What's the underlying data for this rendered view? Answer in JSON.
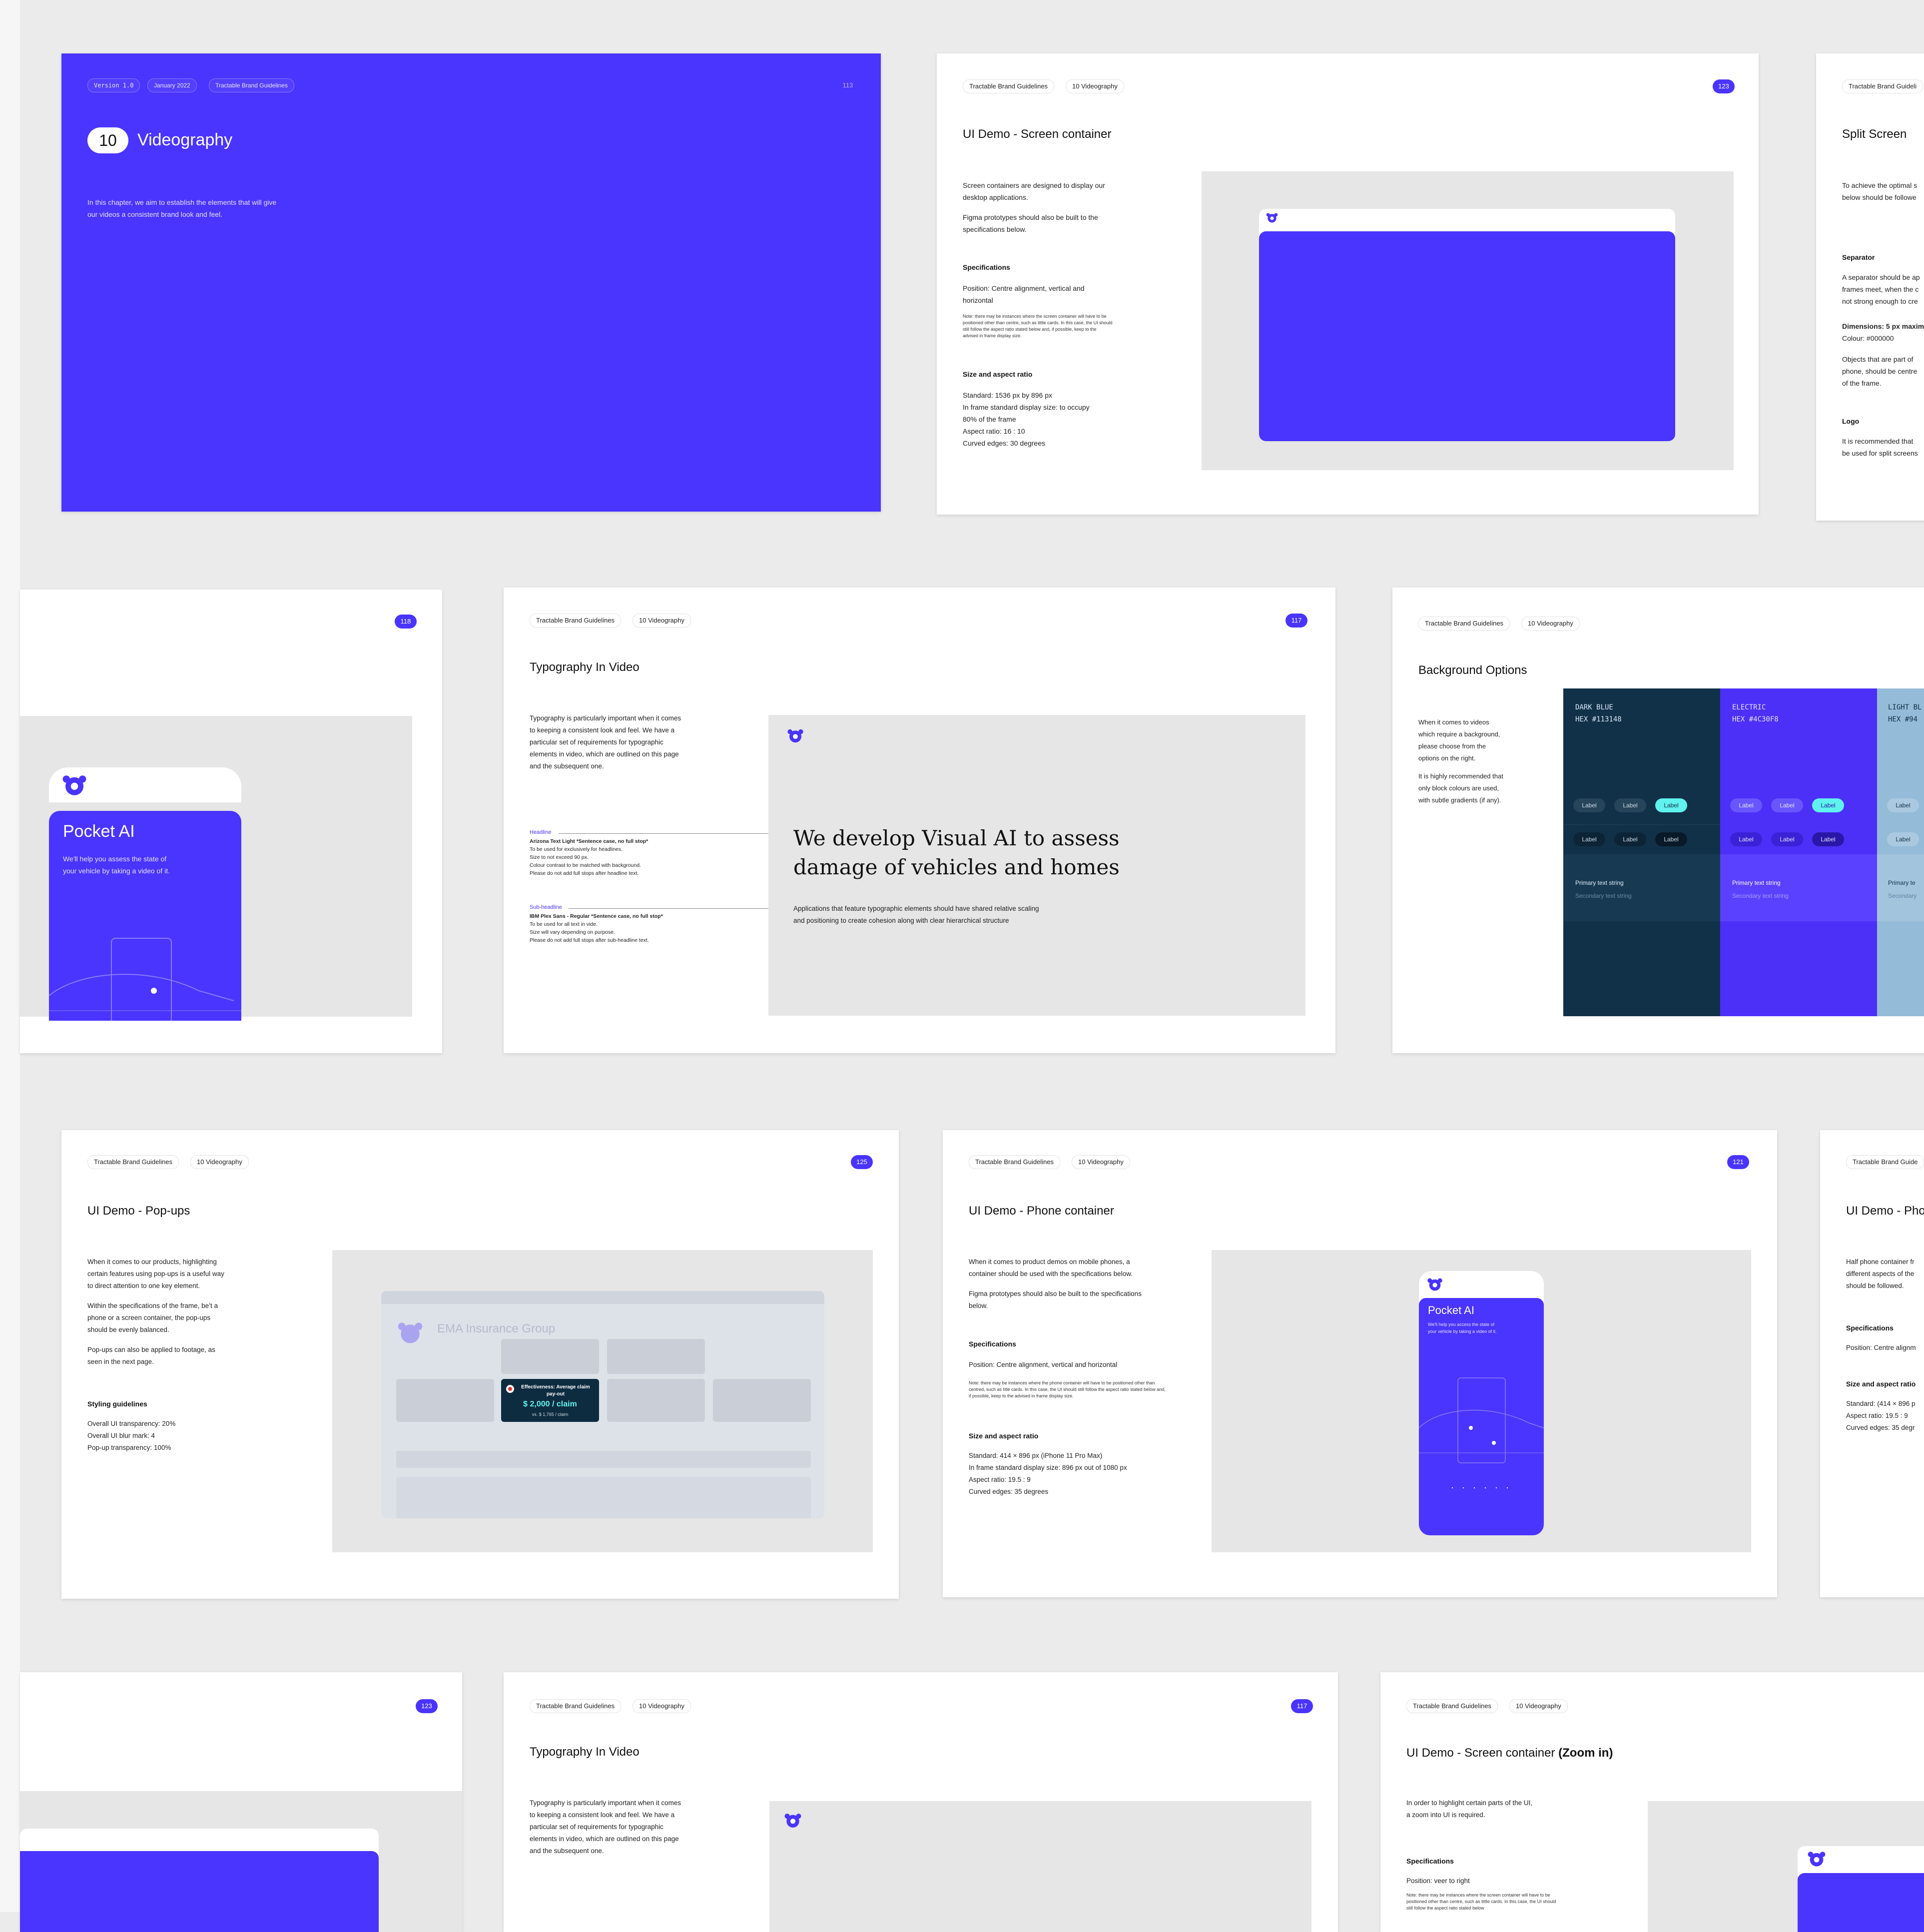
{
  "brand": "Tractable Brand Guidelines",
  "chapter": "10 Videography",
  "colors": {
    "electric": "#4C30F8",
    "dark_blue": "#113148",
    "light_blue": "#94BBD8",
    "gray_bg": "#E6E6E6"
  },
  "slide_cover": {
    "version": "Version 1.0",
    "date": "January 2022",
    "brand": "Tractable Brand Guidelines",
    "page": "113",
    "chapter_num": "10",
    "chapter_title": "Videography",
    "intro_1": "In this chapter, we aim to establish the elements that will give",
    "intro_2": "our videos a consistent brand look and feel."
  },
  "slide_screen": {
    "page": "123",
    "title": "UI Demo - Screen container",
    "p1": "Screen containers are designed to display our desktop applications.",
    "p2": "Figma prototypes should also be built to the specifications below.",
    "spec_head": "Specifications",
    "spec": "Position: Centre alignment, vertical and horizontal",
    "note": "Note: there may be instances where the screen container will have to be positioned other than centre, such as tittle cards. In this case, the UI should still follow the aspect ratio stated below and, if possible, keep to the advised in frame display size.",
    "size_head": "Size and aspect ratio",
    "size_lines": [
      "Standard: 1536 px by 896 px",
      "In frame standard display size: to occupy",
      "80% of the frame",
      "Aspect ratio: 16 : 10",
      "Curved edges: 30 degrees"
    ]
  },
  "slide_split": {
    "brand": "Tractable Brand Guideli",
    "title": "Split Screen",
    "intro": [
      "To achieve the optimal s",
      "below should be followe"
    ],
    "sep_head": "Separator",
    "sep": [
      "A separator should be ap",
      "frames meet, when the c",
      "not strong enough to cre"
    ],
    "dim": "Dimensions: 5 px maxim",
    "colour": "Colour: #000000",
    "objects": [
      "Objects that are part of",
      "phone, should be centre",
      "of the frame."
    ],
    "logo_head": "Logo",
    "logo": [
      "It is recommended that",
      "be used for split screens"
    ]
  },
  "slide_pocket": {
    "page": "118",
    "app_title": "Pocket AI",
    "app_sub": [
      "We'll help you assess the state of",
      "your vehicle by taking a video of it."
    ]
  },
  "slide_typo": {
    "page": "117",
    "title": "Typography In Video",
    "intro": [
      "Typography is particularly important when it comes",
      "to keeping a consistent look and feel. We have a",
      "particular set of requirements for typographic",
      "elements in video, which are outlined on this page",
      "and the subsequent one."
    ],
    "headline_label": "Headline",
    "headline_lines": [
      "Arizona Text Light *Sentence case, no full stop*",
      "To be used for exclusively for headlines.",
      "Size to not exceed 90 px.",
      "Colour contrast to be matched with background.",
      "Please do not add full stops after headline text."
    ],
    "sub_label": "Sub-headline",
    "sub_lines": [
      "IBM Plex Sans - Regular *Sentence case, no full stop*",
      "To be used for all text in vide.",
      "Size will vary depending on purpose.",
      "Please do not add full stops after sub-headline text."
    ],
    "sample_headline_1": "We develop Visual AI to assess",
    "sample_headline_2": "damage of vehicles and homes",
    "sample_sub_1": "Applications that feature typographic elements should have shared relative scaling",
    "sample_sub_2": "and positioning to create cohesion along with clear hierarchical structure"
  },
  "slide_bg": {
    "title": "Background Options",
    "p1": [
      "When it comes to videos",
      "which require a background,",
      "please choose from the",
      "options on the right."
    ],
    "p2": [
      "It is highly recommended that",
      "only block colours are used,",
      "with subtle gradients (if any)."
    ],
    "swatches": [
      {
        "name": "DARK BLUE",
        "hex": "HEX #113148"
      },
      {
        "name": "ELECTRIC",
        "hex": "HEX #4C30F8"
      },
      {
        "name": "LIGHT BL",
        "hex": "HEX #94"
      }
    ],
    "label": "Label",
    "primary": "Primary text string",
    "secondary": "Secondary text string",
    "primary_cut": "Primary te",
    "secondary_cut": "Secondary"
  },
  "slide_popups": {
    "page": "125",
    "title": "UI Demo - Pop-ups",
    "p1": [
      "When it comes to our products, highlighting",
      "certain features using pop-ups is a useful way",
      "to direct attention to one key element."
    ],
    "p2": [
      "Within the specifications of the frame, be’t a",
      "phone or a screen container, the pop-ups",
      "should be evenly balanced."
    ],
    "p3": [
      "Pop-ups can also be applied to footage, as",
      "seen in the next page."
    ],
    "style_head": "Styling guidelines",
    "style_lines": [
      "Overall UI transparency: 20%",
      "Overall UI blur mark: 4",
      "Pop-up transparency: 100%"
    ],
    "ui_title": "EMA Insurance Group",
    "popup_label": "Effectiveness: Average claim pay-out",
    "popup_value": "$ 2,000 / claim",
    "popup_sub": "vs. $ 1,765 / claim"
  },
  "slide_phone": {
    "page": "121",
    "title": "UI Demo - Phone container",
    "p1": [
      "When it comes to product demos on mobile phones, a",
      "container should be used with the specifications below."
    ],
    "p2": [
      "Figma prototypes should also be built to the specifications",
      "below."
    ],
    "spec_head": "Specifications",
    "spec": "Position: Centre alignment, vertical and horizontal",
    "note": "Note: there may be instances where the phone container will have to be positioned other than centred, such as title cards. In this case, the UI should still follow the aspect ratio stated below and, if possible, keep to the advised in frame display size.",
    "size_head": "Size and aspect ratio",
    "size_lines": [
      "Standard: 414 × 896 px (iPhone 11 Pro Max)",
      "In frame standard display size: 896 px out of 1080 px",
      "Aspect ratio: 19.5 : 9",
      "Curved edges: 35 degrees"
    ],
    "app_title": "Pocket AI",
    "app_sub": [
      "We'll help you access the state of",
      "your vehicle by taking a video of it."
    ]
  },
  "slide_half": {
    "brand": "Tractable Brand Guide",
    "title": "UI Demo - Pho",
    "intro": [
      "Half phone container fr",
      "different aspects of the",
      "should be followed."
    ],
    "spec_head": "Specifications",
    "spec": "Position: Centre alignm",
    "size_head": "Size and aspect ratio",
    "size_lines": [
      "Standard: (414 × 896 p",
      "Aspect ratio: 19.5 : 9",
      "Curved edges: 35 degr"
    ]
  },
  "slide_b1": {
    "page": "123"
  },
  "slide_b2": {
    "page": "117",
    "title": "Typography In Video",
    "intro": [
      "Typography is particularly important when it comes",
      "to keeping a consistent look and feel. We have a",
      "particular set of requirements for typographic",
      "elements in video, which are outlined on this page",
      "and the subsequent one."
    ]
  },
  "slide_b3": {
    "title": "UI Demo - Screen container",
    "title_bold": "(Zoom in)",
    "intro": [
      "In order to highlight certain parts of the UI,",
      "a zoom into UI is required."
    ],
    "spec_head": "Specifications",
    "spec": "Position: veer to right",
    "note": "Note: there may be instances where the screen container will have to be positioned other than centre, such as tittle cards. In this case, the UI should still follow the aspect ratio stated below"
  }
}
